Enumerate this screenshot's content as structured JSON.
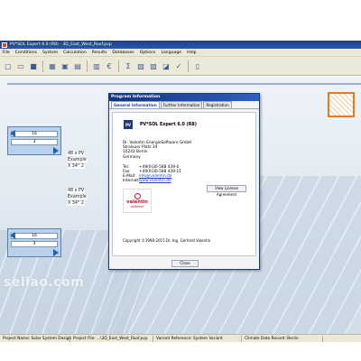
{
  "window": {
    "title": "PV*SOL Expert 6.0  (R8)  - 3D_East_West_Roof.pvp"
  },
  "menu": [
    "File",
    "Conditions",
    "System",
    "Calculation",
    "Results",
    "Databases",
    "Options",
    "Language",
    "Help"
  ],
  "toolbar": {
    "icons": [
      "new-file-icon",
      "open-folder-icon",
      "save-icon",
      "module-icon",
      "inverter-icon",
      "chart-icon",
      "calculator-icon",
      "money-icon",
      "sum-icon",
      "table-icon",
      "clipboard-icon",
      "graph-icon",
      "check-icon",
      "book-icon"
    ]
  },
  "workspace": {
    "strings": [
      {
        "num": "16",
        "sub": "3",
        "label": "48 x PV",
        "example": "Example",
        "volt": "X 34° 2"
      },
      {
        "num": "16",
        "sub": "3",
        "label": "48 x PV",
        "example": "Example",
        "volt": "X 34° 2"
      }
    ],
    "watermark": "sellao.com"
  },
  "dialog": {
    "title": "Program Information",
    "tabs": [
      "General Information",
      "Further Information",
      "Registration"
    ],
    "logo_text": "PV",
    "product": "PV*SOL Expert 6.0 (R8)",
    "address": [
      "Dr. Valentin EnergieSoftware GmbH",
      "Stralauer Platz 34",
      "10243 Berlin",
      "Germany"
    ],
    "contacts": [
      {
        "label": "Tel:",
        "value": "+49(0)30-588 439-0"
      },
      {
        "label": "Fax:",
        "value": "+49(0)30-588 439-11"
      },
      {
        "label": "E-Mail:",
        "value": "info@valentin.de"
      },
      {
        "label": "Internet:",
        "value": "www.valentin.de"
      }
    ],
    "brand_name": "valentin",
    "brand_sub": "software",
    "license_button": "View License Agreement",
    "copyright": "Copyright ©1998-2015 Dr. Ing. Gerhard Valentin",
    "close_button": "Close"
  },
  "status": [
    "Project Name: Solar System Design",
    "Project File: ...\\3D_East_West_Roof.pvp",
    "Variant Reference: System Variant",
    "Climate Data Record: Berlin"
  ]
}
